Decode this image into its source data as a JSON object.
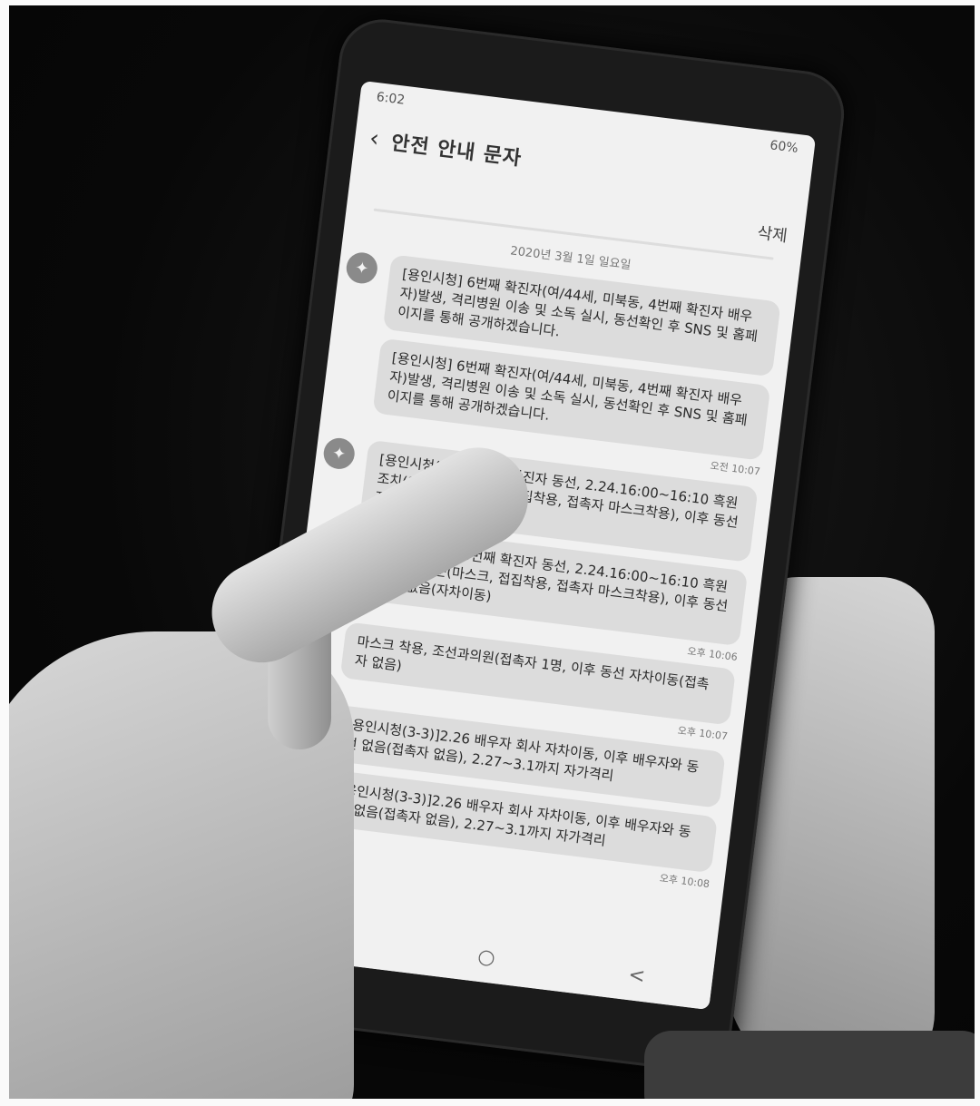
{
  "status_bar": {
    "time": "6:02",
    "battery": "60%"
  },
  "app_bar": {
    "back_icon": "chevron-left-icon",
    "title": "안전 안내 문자",
    "delete_label": "삭제"
  },
  "date_separator": "2020년 3월 1일 일요일",
  "sender_icon": "pin-icon",
  "messages": [
    {
      "text": "[용인시청] 6번째 확진자(여/44세, 미북동, 4번째 확진자 배우자)발생, 격리병원 이송 및 소독 실시, 동선확인 후 SNS 및 홈페이지를 통해 공개하겠습니다.",
      "time": ""
    },
    {
      "text": "[용인시청] 6번째 확진자(여/44세, 미북동, 4번째 확진자 배우자)발생, 격리병원 이송 및 소독 실시, 동선확인 후 SNS 및 홈페이지를 통해 공개하겠습니다.",
      "time": "오전 10:07"
    },
    {
      "text": "[용인시청(3-1)]6번째 확진자 동선, 2.24.16:00~16:10 흑원조치(약원방문(마스크, 접집착용, 접촉자 마스크착용), 이후 동선 접촉자 없음(자차이동)",
      "time": ""
    },
    {
      "text": "[용인시청(3-1)]6번째 확진자 동선, 2.24.16:00~16:10 흑원조치(약원방문(마스크, 접집착용, 접촉자 마스크착용), 이후 동선 접촉자 없음(자차이동)",
      "time": "오후 10:06"
    },
    {
      "text": "마스크 착용, 조선과의원(접촉자 1명, 이후 동선 자차이동(접촉자 없음)",
      "time": "오후 10:07"
    },
    {
      "text": "[용인시청(3-3)]2.26 배우자 회사 자차이동, 이후 배우자와 동선 없음(접촉자 없음), 2.27~3.1까지 자가격리",
      "time": ""
    },
    {
      "text": "[용인시청(3-3)]2.26 배우자 회사 자차이동, 이후 배우자와 동선 없음(접촉자 없음), 2.27~3.1까지 자가격리",
      "time": "오후 10:08"
    }
  ],
  "nav_bar": {
    "recents": "|||",
    "home": "○",
    "back": "<"
  }
}
